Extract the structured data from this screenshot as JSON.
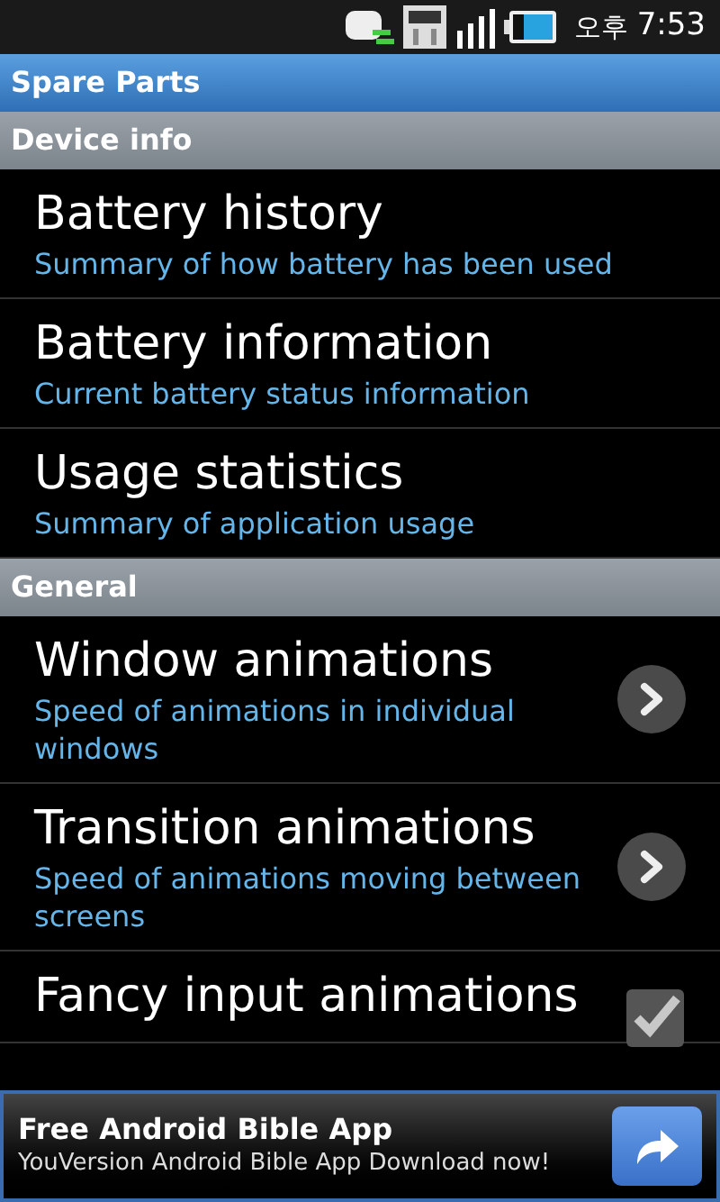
{
  "status_bar": {
    "ampm": "오후",
    "time": "7:53"
  },
  "app_bar": {
    "title": "Spare Parts"
  },
  "sections": [
    {
      "header": "Device info",
      "items": [
        {
          "kind": "plain",
          "title": "Battery history",
          "summary": "Summary of how battery has been used"
        },
        {
          "kind": "plain",
          "title": "Battery information",
          "summary": "Current battery status information"
        },
        {
          "kind": "plain",
          "title": "Usage statistics",
          "summary": "Summary of application usage"
        }
      ]
    },
    {
      "header": "General",
      "items": [
        {
          "kind": "chevron",
          "title": "Window animations",
          "summary": "Speed of animations in individual windows"
        },
        {
          "kind": "chevron",
          "title": "Transition animations",
          "summary": "Speed of animations moving between screens"
        },
        {
          "kind": "checkbox",
          "title": "Fancy input animations",
          "checked": true
        }
      ]
    }
  ],
  "ad": {
    "title": "Free Android Bible App",
    "text": "YouVersion Android Bible App Download now!"
  }
}
